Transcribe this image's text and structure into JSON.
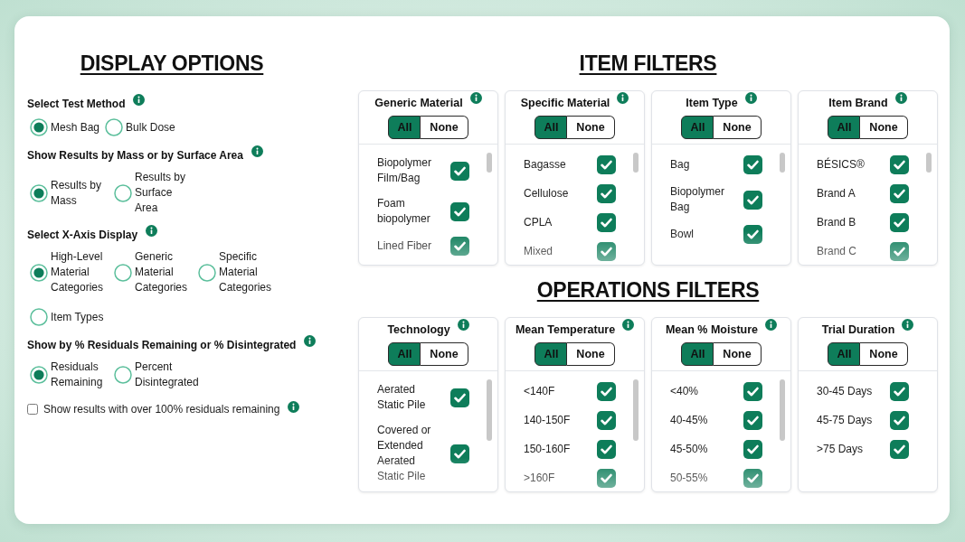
{
  "display_options": {
    "title": "DISPLAY OPTIONS",
    "sections": [
      {
        "kind": "radio",
        "heading": "Select Test Method",
        "options": [
          {
            "label": "Mesh Bag",
            "selected": true
          },
          {
            "label": "Bulk Dose",
            "selected": false
          }
        ]
      },
      {
        "kind": "radio",
        "heading": "Show Results by Mass or by Surface Area",
        "options": [
          {
            "label": "Results by Mass",
            "selected": true
          },
          {
            "label": "Results by Surface Area",
            "selected": false
          }
        ]
      },
      {
        "kind": "radio",
        "heading": "Select X-Axis Display",
        "options": [
          {
            "label": "High-Level Material Categories",
            "selected": true
          },
          {
            "label": "Generic Material Categories",
            "selected": false
          },
          {
            "label": "Specific Material Categories",
            "selected": false
          },
          {
            "label": "Item Types",
            "selected": false
          }
        ]
      },
      {
        "kind": "radio",
        "heading": "Show by % Residuals Remaining or % Disintegrated",
        "options": [
          {
            "label": "Residuals Remaining",
            "selected": true
          },
          {
            "label": "Percent Disintegrated",
            "selected": false
          }
        ]
      },
      {
        "kind": "checkbox",
        "label": "Show results with over 100% residuals remaining",
        "checked": false
      }
    ]
  },
  "item_filters": {
    "title": "ITEM FILTERS",
    "cards": [
      {
        "title": "Generic Material",
        "toggle": [
          {
            "label": "All",
            "selected": true
          },
          {
            "label": "None",
            "selected": false
          }
        ],
        "scrollable": true,
        "items": [
          {
            "label": "Biopolymer Film/Bag",
            "checked": true
          },
          {
            "label": "Foam biopolymer",
            "checked": true
          },
          {
            "label": "Lined Fiber",
            "checked": true
          }
        ]
      },
      {
        "title": "Specific Material",
        "toggle": [
          {
            "label": "All",
            "selected": true
          },
          {
            "label": "None",
            "selected": false
          }
        ],
        "scrollable": true,
        "items": [
          {
            "label": "Bagasse",
            "checked": true
          },
          {
            "label": "Cellulose",
            "checked": true
          },
          {
            "label": "CPLA",
            "checked": true
          },
          {
            "label": "Mixed",
            "checked": true
          }
        ]
      },
      {
        "title": "Item Type",
        "toggle": [
          {
            "label": "All",
            "selected": true
          },
          {
            "label": "None",
            "selected": false
          }
        ],
        "scrollable": true,
        "items": [
          {
            "label": "Bag",
            "checked": true
          },
          {
            "label": "Biopolymer Bag",
            "checked": true
          },
          {
            "label": "Bowl",
            "checked": true
          }
        ]
      },
      {
        "title": "Item Brand",
        "toggle": [
          {
            "label": "All",
            "selected": true
          },
          {
            "label": "None",
            "selected": false
          }
        ],
        "scrollable": true,
        "items": [
          {
            "label": "BÉSICS®",
            "checked": true
          },
          {
            "label": "Brand A",
            "checked": true
          },
          {
            "label": "Brand B",
            "checked": true
          },
          {
            "label": "Brand C",
            "checked": true
          }
        ]
      }
    ]
  },
  "operations_filters": {
    "title": "OPERATIONS FILTERS",
    "cards": [
      {
        "title": "Technology",
        "toggle": [
          {
            "label": "All",
            "selected": true
          },
          {
            "label": "None",
            "selected": false
          }
        ],
        "scrollable": true,
        "items": [
          {
            "label": "Aerated Static Pile",
            "checked": true
          },
          {
            "label": "Covered or Extended Aerated Static Pile",
            "checked": true
          }
        ]
      },
      {
        "title": "Mean Temperature",
        "toggle": [
          {
            "label": "All",
            "selected": true
          },
          {
            "label": "None",
            "selected": false
          }
        ],
        "scrollable": true,
        "items": [
          {
            "label": "<140F",
            "checked": true
          },
          {
            "label": "140-150F",
            "checked": true
          },
          {
            "label": "150-160F",
            "checked": true
          },
          {
            "label": ">160F",
            "checked": true
          }
        ]
      },
      {
        "title": "Mean % Moisture",
        "toggle": [
          {
            "label": "All",
            "selected": true
          },
          {
            "label": "None",
            "selected": false
          }
        ],
        "scrollable": true,
        "items": [
          {
            "label": "<40%",
            "checked": true
          },
          {
            "label": "40-45%",
            "checked": true
          },
          {
            "label": "45-50%",
            "checked": true
          },
          {
            "label": "50-55%",
            "checked": true
          }
        ]
      },
      {
        "title": "Trial Duration",
        "toggle": [
          {
            "label": "All",
            "selected": true
          },
          {
            "label": "None",
            "selected": false
          }
        ],
        "scrollable": false,
        "items": [
          {
            "label": "30-45 Days",
            "checked": true
          },
          {
            "label": "45-75 Days",
            "checked": true
          },
          {
            "label": ">75 Days",
            "checked": true
          }
        ]
      }
    ]
  }
}
